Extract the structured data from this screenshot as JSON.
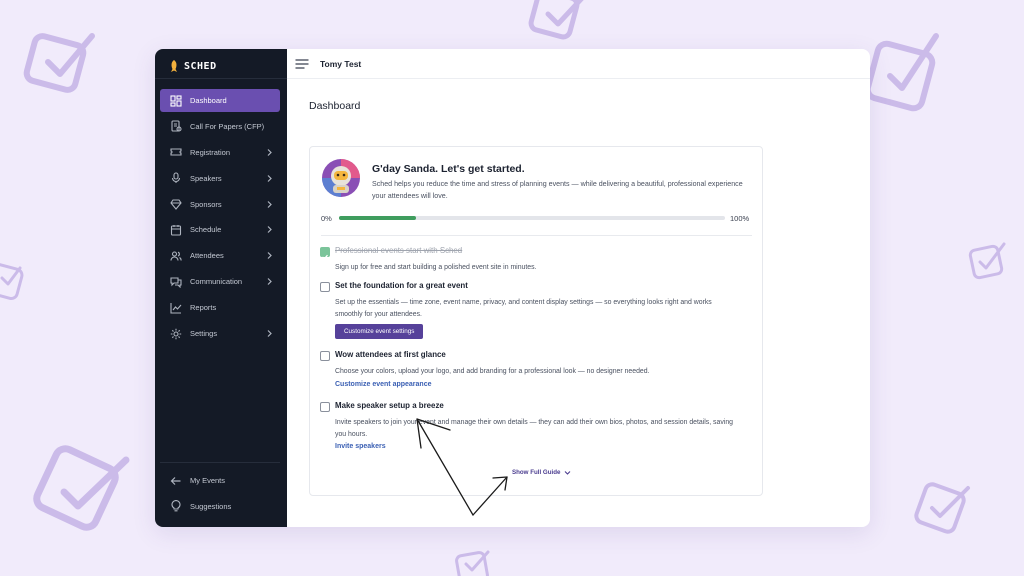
{
  "app": {
    "logo_text": "SCHED",
    "user_name": "Tomy Test",
    "page_title": "Dashboard"
  },
  "sidebar": {
    "items": [
      {
        "label": "Dashboard",
        "icon": "dashboard-icon",
        "active": true,
        "chevron": false
      },
      {
        "label": "Call For Papers (CFP)",
        "icon": "cfp-icon",
        "chevron": false
      },
      {
        "label": "Registration",
        "icon": "ticket-icon",
        "chevron": true
      },
      {
        "label": "Speakers",
        "icon": "microphone-icon",
        "chevron": true
      },
      {
        "label": "Sponsors",
        "icon": "diamond-icon",
        "chevron": true
      },
      {
        "label": "Schedule",
        "icon": "calendar-icon",
        "chevron": true
      },
      {
        "label": "Attendees",
        "icon": "users-icon",
        "chevron": true
      },
      {
        "label": "Communication",
        "icon": "chat-icon",
        "chevron": true
      },
      {
        "label": "Reports",
        "icon": "chart-icon",
        "chevron": false
      },
      {
        "label": "Settings",
        "icon": "gear-icon",
        "chevron": true
      }
    ],
    "bottom": [
      {
        "label": "My Events",
        "icon": "arrow-left-icon"
      },
      {
        "label": "Suggestions",
        "icon": "lightbulb-icon"
      }
    ]
  },
  "onboarding": {
    "greeting": "G'day Sanda. Let's get started.",
    "intro": "Sched helps you reduce the time and stress of planning events — while delivering a beautiful, professional experience your attendees will love.",
    "progress_start": "0%",
    "progress_end": "100%",
    "progress_value": 0.2,
    "tasks": [
      {
        "title": "Professional events start with Sched",
        "done": true,
        "description": "Sign up for free and start building a polished event site in minutes."
      },
      {
        "title": "Set the foundation for a great event",
        "done": false,
        "description": "Set up the essentials — time zone, event name, privacy, and content display settings — so everything looks right and works smoothly for your attendees.",
        "button": "Customize event settings"
      },
      {
        "title": "Wow attendees at first glance",
        "done": false,
        "description": "Choose your colors, upload your logo, and add branding for a professional look — no designer needed.",
        "link": "Customize event appearance"
      },
      {
        "title": "Make speaker setup a breeze",
        "done": false,
        "description": "Invite speakers to join your event and manage their own details — they can add their own bios, photos, and session details, saving you hours.",
        "link": "Invite speakers"
      }
    ],
    "show_full_guide": "Show Full Guide"
  },
  "colors": {
    "accent": "#6a4fb0",
    "button": "#56419a",
    "progress": "#3f9d5e",
    "sidebar": "#141a26",
    "link": "#3a5fb3"
  }
}
